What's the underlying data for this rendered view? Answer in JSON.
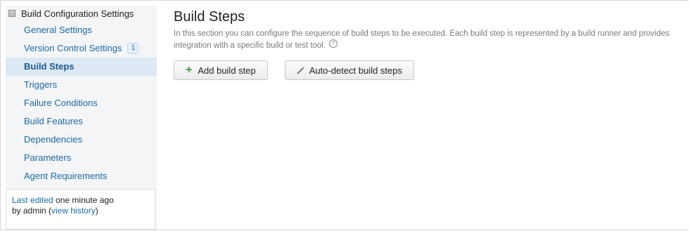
{
  "sidebar": {
    "header": "Build Configuration Settings",
    "items": [
      {
        "label": "General Settings",
        "badge": ""
      },
      {
        "label": "Version Control Settings",
        "badge": "1"
      },
      {
        "label": "Build Steps",
        "badge": "",
        "active": true
      },
      {
        "label": "Triggers",
        "badge": ""
      },
      {
        "label": "Failure Conditions",
        "badge": ""
      },
      {
        "label": "Build Features",
        "badge": ""
      },
      {
        "label": "Dependencies",
        "badge": ""
      },
      {
        "label": "Parameters",
        "badge": ""
      },
      {
        "label": "Agent Requirements",
        "badge": ""
      }
    ],
    "edited": {
      "last_edited_link": "Last edited",
      "time": " one minute ago",
      "by": "by admin (",
      "history_link": "view history",
      "close": ")"
    }
  },
  "main": {
    "title": "Build Steps",
    "description": "In this section you can configure the sequence of build steps to be executed. Each build step is represented by a build runner and provides integration with a specific build or test tool.",
    "help_glyph": "?",
    "add_button": "Add build step",
    "autodetect_button": "Auto-detect build steps"
  },
  "colors": {
    "link": "#1d6aa5",
    "active_bg": "#dce9f5",
    "sidebar_bg": "#f4f5f7",
    "plus_green": "#3c9a3c"
  },
  "icons": {
    "sidebar_header": "settings-grid-icon",
    "help": "help-icon",
    "add": "plus-icon",
    "autodetect": "magic-wand-icon"
  }
}
